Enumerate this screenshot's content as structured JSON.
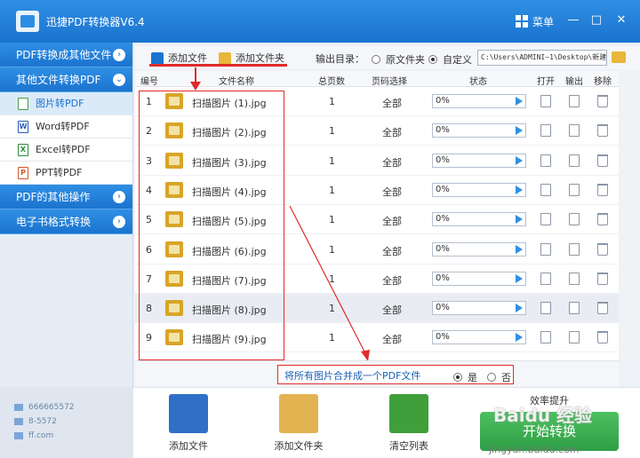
{
  "window": {
    "title": "迅捷PDF转换器V6.4",
    "menu_label": "菜单",
    "minimize": "—",
    "maximize": "□",
    "close": "✕"
  },
  "sidebar": {
    "sections": [
      {
        "label": "PDF转换成其他文件"
      },
      {
        "label": "其他文件转换PDF"
      }
    ],
    "items": [
      {
        "label": "图片转PDF",
        "icon": "image-file-icon"
      },
      {
        "label": "Word转PDF",
        "icon": "word-file-icon"
      },
      {
        "label": "Excel转PDF",
        "icon": "excel-file-icon"
      },
      {
        "label": "PPT转PDF",
        "icon": "ppt-file-icon"
      }
    ],
    "sections_bottom": [
      {
        "label": "PDF的其他操作"
      },
      {
        "label": "电子书格式转换"
      }
    ],
    "info": [
      "666665572",
      "8-5572",
      "ff.com"
    ]
  },
  "toolbar": {
    "add_file": "添加文件",
    "add_folder": "添加文件夹",
    "output_label": "输出目录：",
    "radio_source": "原文件夹",
    "radio_custom": "自定义",
    "path": "C:\\Users\\ADMINI~1\\Desktop\\新建文"
  },
  "table": {
    "headers": {
      "no": "编号",
      "name": "文件名称",
      "pages": "总页数",
      "select": "页码选择",
      "status": "状态",
      "open": "打开",
      "output": "输出",
      "remove": "移除"
    },
    "rows": [
      {
        "no": "1",
        "name": "扫描图片 (1).jpg",
        "pages": "1",
        "select": "全部",
        "progress": "0%"
      },
      {
        "no": "2",
        "name": "扫描图片 (2).jpg",
        "pages": "1",
        "select": "全部",
        "progress": "0%"
      },
      {
        "no": "3",
        "name": "扫描图片 (3).jpg",
        "pages": "1",
        "select": "全部",
        "progress": "0%"
      },
      {
        "no": "4",
        "name": "扫描图片 (4).jpg",
        "pages": "1",
        "select": "全部",
        "progress": "0%"
      },
      {
        "no": "5",
        "name": "扫描图片 (5).jpg",
        "pages": "1",
        "select": "全部",
        "progress": "0%"
      },
      {
        "no": "6",
        "name": "扫描图片 (6).jpg",
        "pages": "1",
        "select": "全部",
        "progress": "0%"
      },
      {
        "no": "7",
        "name": "扫描图片 (7).jpg",
        "pages": "1",
        "select": "全部",
        "progress": "0%"
      },
      {
        "no": "8",
        "name": "扫描图片 (8).jpg",
        "pages": "1",
        "select": "全部",
        "progress": "0%"
      },
      {
        "no": "9",
        "name": "扫描图片 (9).jpg",
        "pages": "1",
        "select": "全部",
        "progress": "0%"
      }
    ]
  },
  "merge": {
    "text": "将所有图片合并成一个PDF文件",
    "yes": "是",
    "no": "否"
  },
  "bottom": {
    "add_file": "添加文件",
    "add_folder": "添加文件夹",
    "clear_list": "清空列表",
    "efficiency": "效率提升",
    "start": "开始转换",
    "watermark": "Baidu 经验",
    "watermark_url": "jingyan.baidu.com"
  },
  "colors": {
    "accent": "#1a73cf",
    "annotation": "#e02a2a",
    "start": "#2f9e45"
  }
}
